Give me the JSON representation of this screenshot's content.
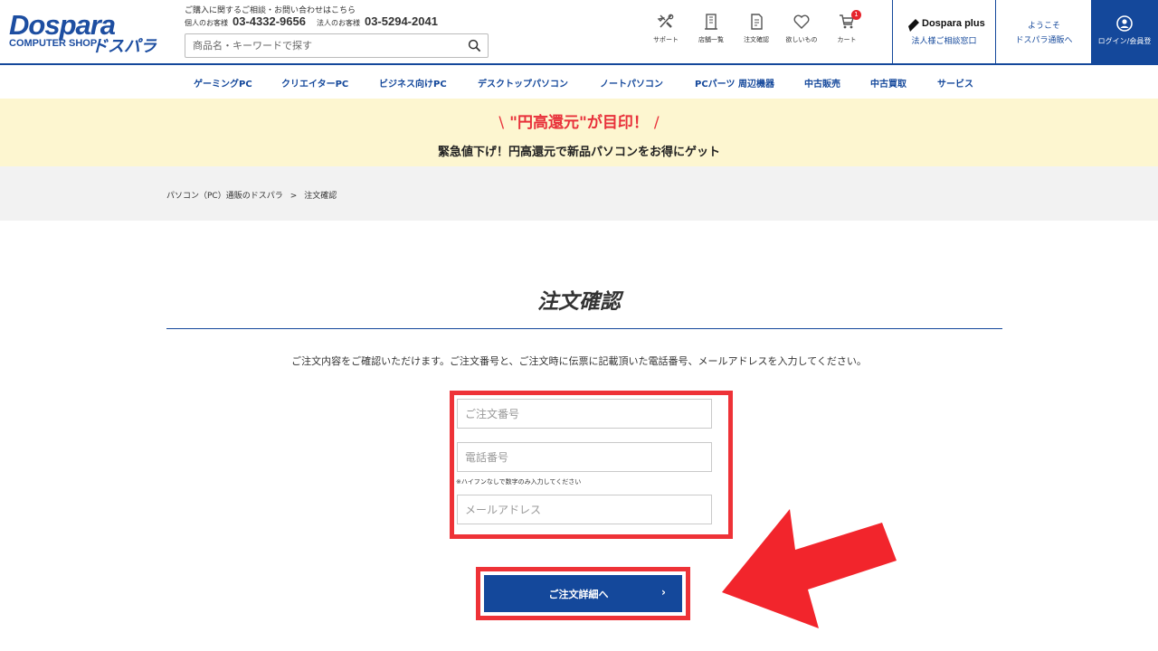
{
  "header": {
    "logo_text": "Dospara",
    "logo_sub": "COMPUTER SHOP",
    "logo_kana": "ドスパラ",
    "contact_line": "ご購入に関するご相談・お問い合わせはこちら",
    "individual_label": "個人のお客様",
    "individual_phone": "03-4332-9656",
    "corporate_label": "法人のお客様",
    "corporate_phone": "03-5294-2041",
    "search_placeholder": "商品名・キーワードで探す",
    "icons": [
      {
        "name": "support",
        "label": "サポート"
      },
      {
        "name": "stores",
        "label": "店舗一覧"
      },
      {
        "name": "order-check",
        "label": "注文確認"
      },
      {
        "name": "wishlist",
        "label": "欲しいもの"
      },
      {
        "name": "cart",
        "label": "カート",
        "badge": "1"
      }
    ],
    "plus_title": "Dospara plus",
    "plus_sub": "法人様ご相談窓口",
    "welcome_line1": "ようこそ",
    "welcome_line2": "ドスパラ通販へ",
    "login_label": "ログイン/会員登"
  },
  "nav": [
    "ゲーミングPC",
    "クリエイターPC",
    "ビジネス向けPC",
    "デスクトップパソコン",
    "ノートパソコン",
    "PCパーツ 周辺機器",
    "中古販売",
    "中古買取",
    "サービス"
  ],
  "banner": {
    "headline": "\"円高還元\"が目印！",
    "subline": "緊急値下げ！円高還元で新品パソコンをお得にゲット"
  },
  "breadcrumb": {
    "home": "パソコン（PC）通販のドスパラ",
    "separator": ">",
    "current": "注文確認"
  },
  "main": {
    "title": "注文確認",
    "instruction": "ご注文内容をご確認いただけます。ご注文番号と、ご注文時に伝票に記載頂いた電話番号、メールアドレスを入力してください。",
    "order_number_placeholder": "ご注文番号",
    "phone_placeholder": "電話番号",
    "phone_note": "※ハイフンなしで数字のみ入力してください",
    "email_placeholder": "メールアドレス",
    "submit_label": "ご注文詳細へ",
    "submit_chevron": "›"
  },
  "colors": {
    "brand_blue": "#14489b",
    "highlight_red": "#ee3237",
    "banner_bg": "#fdf6d0"
  }
}
